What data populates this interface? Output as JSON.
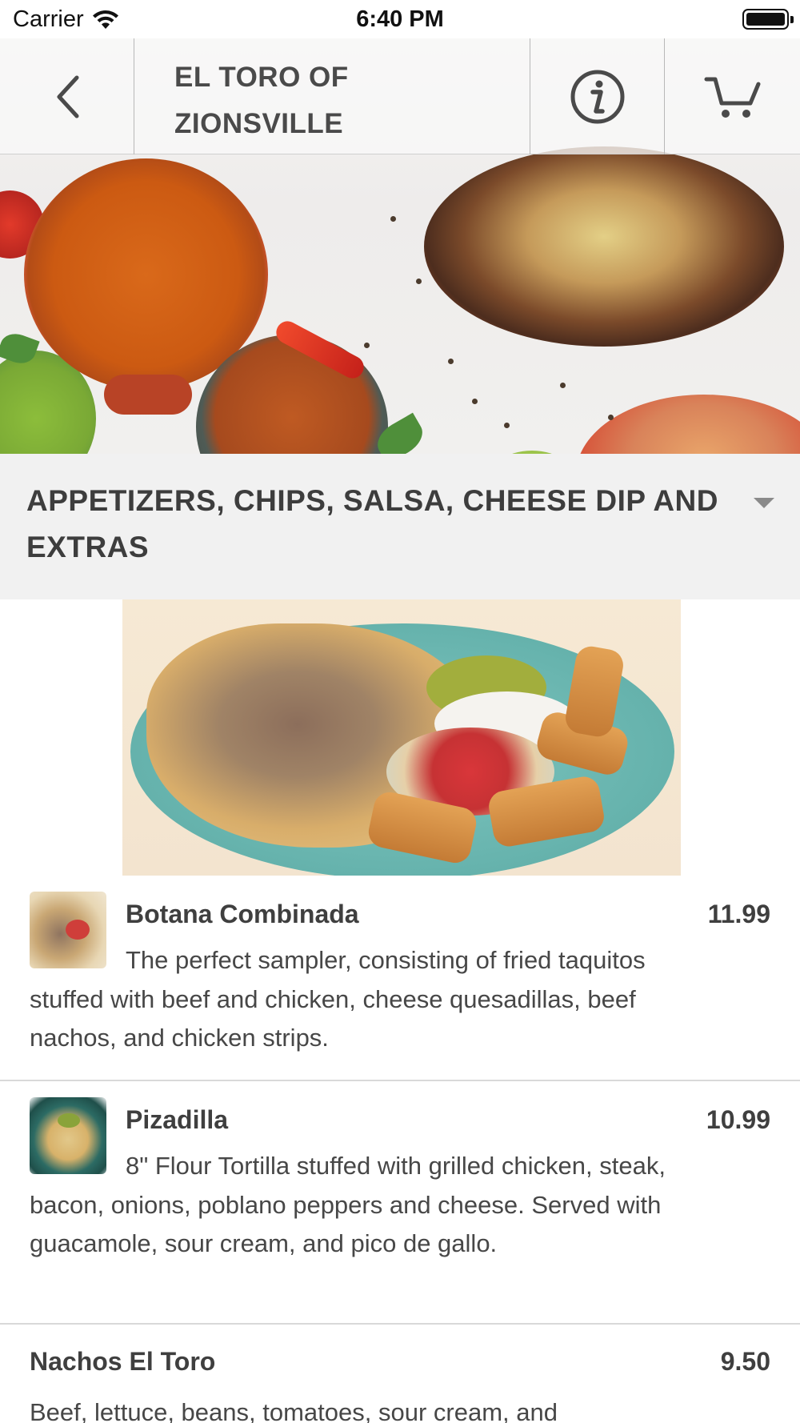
{
  "status_bar": {
    "carrier": "Carrier",
    "time": "6:40 PM"
  },
  "header": {
    "title_line1": "EL TORO OF",
    "title_line2": "ZIONSVILLE",
    "back_icon": "chevron-left-icon",
    "info_icon": "info-icon",
    "cart_icon": "cart-icon"
  },
  "category": {
    "title": "APPETIZERS, CHIPS, SALSA, CHEESE DIP AND EXTRAS",
    "dropdown_icon": "caret-down-icon"
  },
  "menu_items": [
    {
      "name": "Botana Combinada",
      "price": "11.99",
      "description": "The perfect sampler, consisting of fried taquitos stuffed with beef and chicken, cheese quesadillas, beef nachos, and chicken strips."
    },
    {
      "name": "Pizadilla",
      "price": "10.99",
      "description": "8\" Flour Tortilla stuffed with grilled chicken, steak, bacon, onions, poblano peppers and cheese. Served with guacamole, sour cream, and pico de gallo."
    },
    {
      "name": "Nachos El Toro",
      "price": "9.50",
      "description": "Beef, lettuce, beans, tomatoes, sour cream, and"
    }
  ],
  "colors": {
    "navbar_bg": "#f8f8f8",
    "category_bg": "#f1f1f1",
    "text": "#3f3f3f",
    "divider": "#d9d9d9"
  }
}
